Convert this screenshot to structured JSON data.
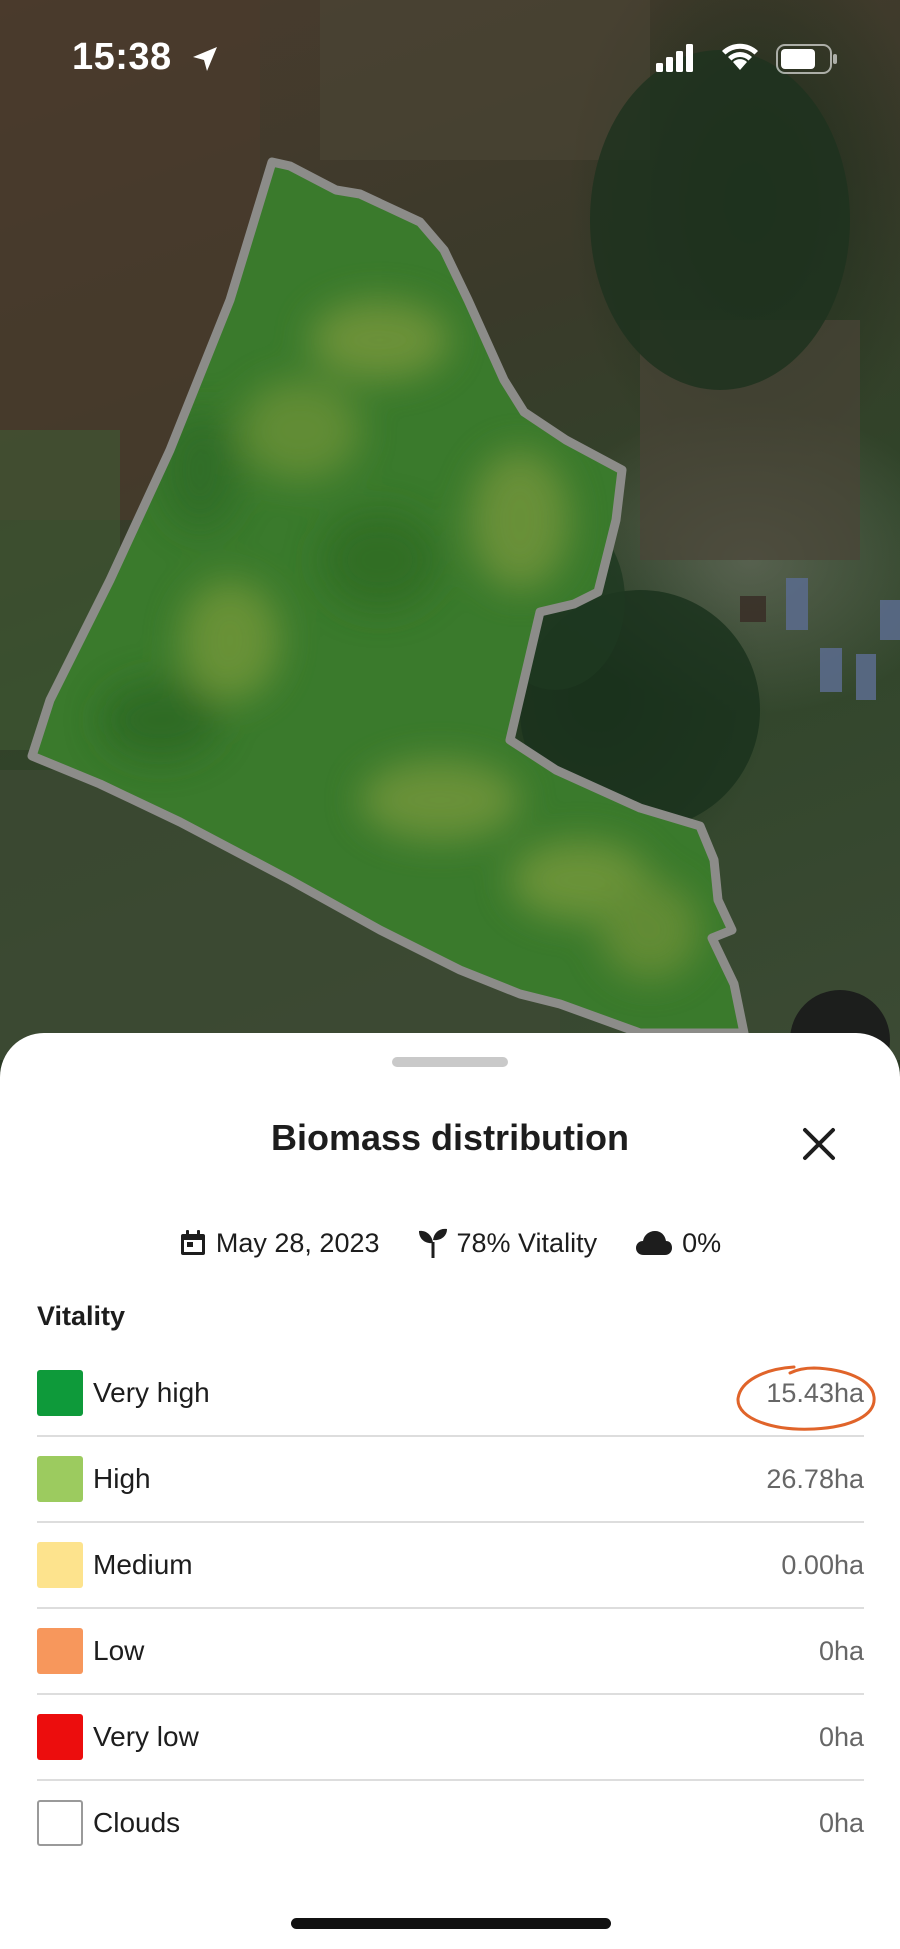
{
  "status_bar": {
    "time": "15:38",
    "icons": [
      "location-arrow-icon",
      "signal-bars-icon",
      "wifi-icon",
      "battery-icon"
    ]
  },
  "map": {
    "field_color": "#3a7a2a",
    "boundary_color": "#8a8a88"
  },
  "sheet": {
    "title": "Biomass distribution",
    "close_icon": "close-icon",
    "meta": {
      "date": "May 28, 2023",
      "vitality": "78% Vitality",
      "clouds": "0%"
    },
    "section_label": "Vitality",
    "legend": [
      {
        "label": "Very high",
        "value": "15.43ha",
        "color": "#0e9a3a",
        "highlighted": true
      },
      {
        "label": "High",
        "value": "26.78ha",
        "color": "#9ccb5f",
        "highlighted": false
      },
      {
        "label": "Medium",
        "value": "0.00ha",
        "color": "#fde38d",
        "highlighted": false
      },
      {
        "label": "Low",
        "value": "0ha",
        "color": "#f7975c",
        "highlighted": false
      },
      {
        "label": "Very low",
        "value": "0ha",
        "color": "#ec0d0d",
        "highlighted": false
      },
      {
        "label": "Clouds",
        "value": "0ha",
        "color": "#ffffff",
        "highlighted": false
      }
    ],
    "highlight_color": "#e0642a"
  }
}
